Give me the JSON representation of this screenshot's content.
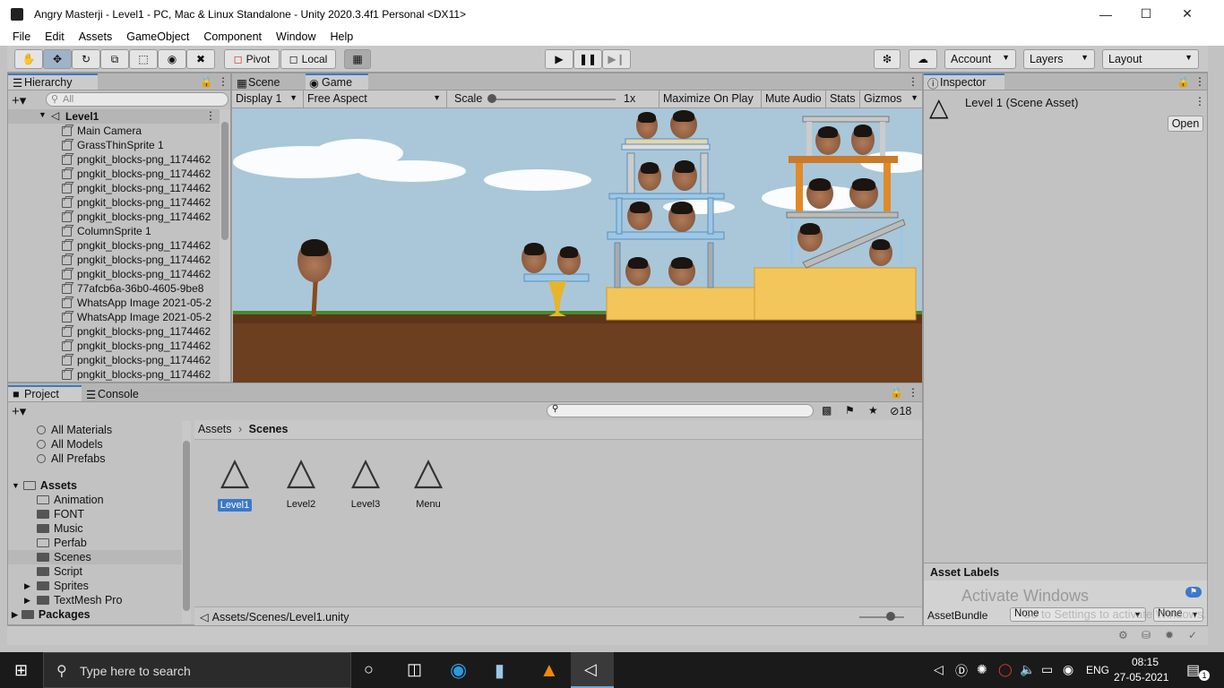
{
  "window": {
    "title": "Angry Masterji - Level1 - PC, Mac & Linux Standalone - Unity 2020.3.4f1 Personal <DX11>"
  },
  "menu": [
    "File",
    "Edit",
    "Assets",
    "GameObject",
    "Component",
    "Window",
    "Help"
  ],
  "toolbar": {
    "pivot": "Pivot",
    "local": "Local",
    "account": "Account",
    "layers": "Layers",
    "layout": "Layout"
  },
  "hierarchy": {
    "tab": "Hierarchy",
    "search_placeholder": "All",
    "scene": "Level1",
    "items": [
      "Main Camera",
      "GrassThinSprite 1",
      "pngkit_blocks-png_1174462",
      "pngkit_blocks-png_1174462",
      "pngkit_blocks-png_1174462",
      "pngkit_blocks-png_1174462",
      "pngkit_blocks-png_1174462",
      "ColumnSprite 1",
      "pngkit_blocks-png_1174462",
      "pngkit_blocks-png_1174462",
      "pngkit_blocks-png_1174462",
      "77afcb6a-36b0-4605-9be8",
      "WhatsApp Image 2021-05-2",
      "WhatsApp Image 2021-05-2",
      "pngkit_blocks-png_1174462",
      "pngkit_blocks-png_1174462",
      "pngkit_blocks-png_1174462",
      "pngkit_blocks-png_1174462"
    ]
  },
  "game": {
    "tabs": [
      "Scene",
      "Game"
    ],
    "display": "Display 1",
    "aspect": "Free Aspect",
    "scale_label": "Scale",
    "scale_value": "1x",
    "maximize": "Maximize On Play",
    "mute": "Mute Audio",
    "stats": "Stats",
    "gizmos": "Gizmos"
  },
  "inspector": {
    "tab": "Inspector",
    "title": "Level 1 (Scene Asset)",
    "open": "Open",
    "asset_labels": "Asset Labels",
    "asset_bundle": "AssetBundle",
    "bundle_value": "None",
    "variant_value": "None",
    "watermark1": "Activate Windows",
    "watermark2": "Go to Settings to activate Windows."
  },
  "project": {
    "tabs": [
      "Project",
      "Console"
    ],
    "hidden_count": "18",
    "favorites": [
      "All Materials",
      "All Models",
      "All Prefabs"
    ],
    "root": "Assets",
    "folders": [
      "Animation",
      "FONT",
      "Music",
      "Perfab",
      "Scenes",
      "Script",
      "Sprites",
      "TextMesh Pro"
    ],
    "packages": "Packages",
    "breadcrumb": [
      "Assets",
      "Scenes"
    ],
    "assets": [
      "Level1",
      "Level2",
      "Level3",
      "Menu"
    ],
    "path": "Assets/Scenes/Level1.unity"
  },
  "taskbar": {
    "search": "Type here to search",
    "lang": "ENG",
    "time": "08:15",
    "date": "27-05-2021",
    "notif": "1"
  },
  "colors": {
    "accent": "#3a79c9",
    "sky": "#a8c6d8",
    "ground": "#6b3f1f",
    "grass": "#4a8a2a",
    "sand": "#f2c65a"
  }
}
